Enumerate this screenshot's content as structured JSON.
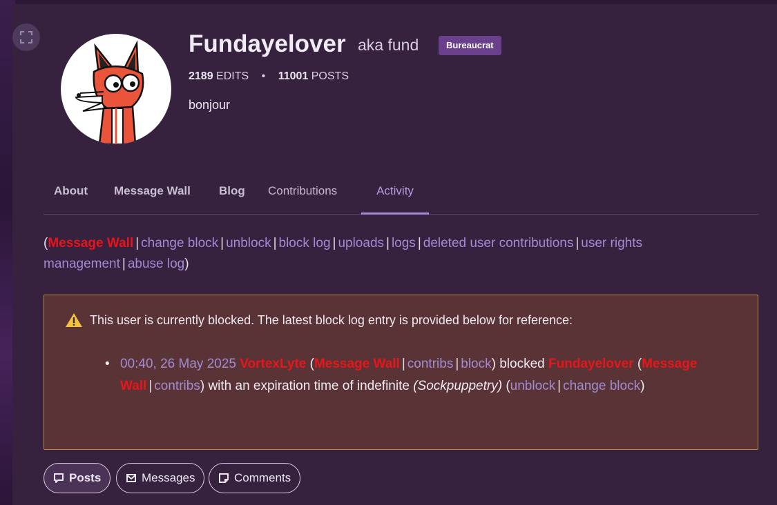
{
  "profile": {
    "username": "Fundayelover",
    "aka": "aka fund",
    "badge": "Bureaucrat",
    "edits_count": "2189",
    "edits_label": "EDITS",
    "posts_count": "11001",
    "posts_label": "POSTS",
    "bio": "bonjour"
  },
  "tabs": [
    "About",
    "Message Wall",
    "Blog",
    "Contributions",
    "Activity"
  ],
  "active_tab": "Activity",
  "tool_links": {
    "message_wall": "Message Wall",
    "change_block": "change block",
    "unblock": "unblock",
    "block_log": "block log",
    "uploads": "uploads",
    "logs": "logs",
    "deleted_contribs": "deleted user contributions",
    "user_rights": "user rights management",
    "abuse_log": "abuse log"
  },
  "block_notice": {
    "message": "This user is currently blocked. The latest block log entry is provided below for reference:",
    "timestamp": "00:40, 26 May 2025",
    "blocker": "VortexLyte",
    "blocker_wall": "Message Wall",
    "blocker_contribs": "contribs",
    "blocker_block": "block",
    "action": "blocked",
    "target": "Fundayelover",
    "target_wall": "Message Wall",
    "target_contribs": "contribs",
    "expiry_text": "with an expiration time of indefinite",
    "reason": "(Sockpuppetry)",
    "unblock": "unblock",
    "change_block": "change block"
  },
  "feed_tabs": {
    "posts": "Posts",
    "messages": "Messages",
    "comments": "Comments"
  },
  "colors": {
    "panel": "#36213f",
    "link": "#a08cd2",
    "red_link": "#e8151a",
    "badge": "#6a3f8c",
    "notice_bg": "#5a3336",
    "notice_border": "#b88a45"
  }
}
